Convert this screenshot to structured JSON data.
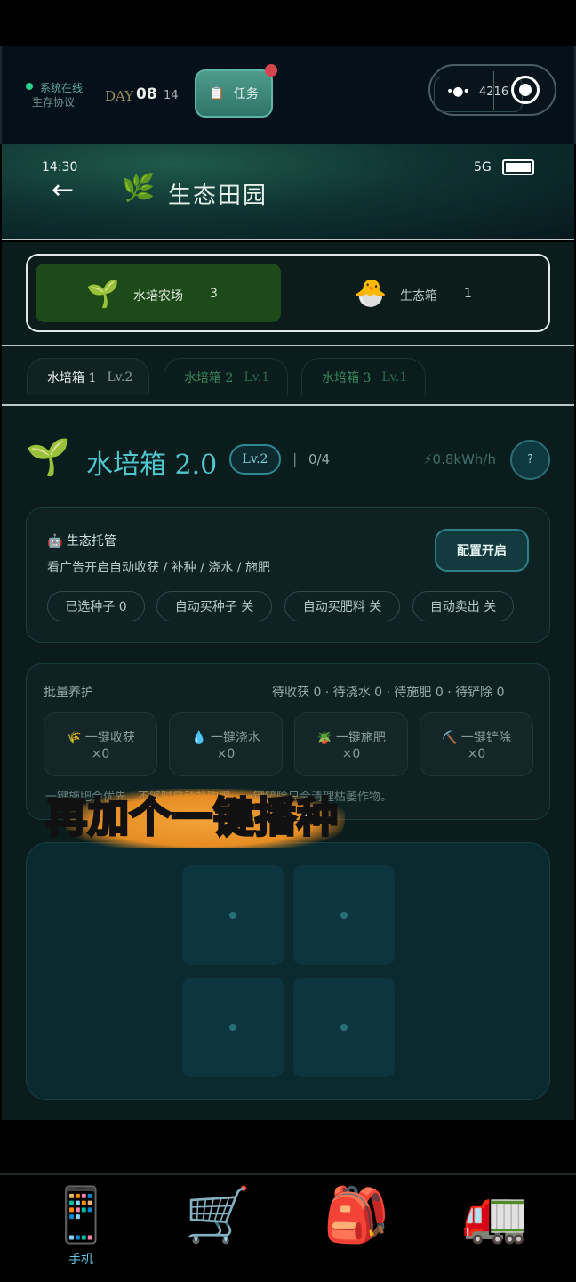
{
  "system": {
    "status": "系统在线",
    "protocol": "生存协议"
  },
  "day": {
    "label": "DAY",
    "value": "08",
    "sub": "14"
  },
  "task_button": {
    "icon": "clipboard-icon",
    "label": "任务"
  },
  "coins": {
    "value": "4216"
  },
  "statusbar": {
    "time": "14:30",
    "network": "5G"
  },
  "app": {
    "title": "生态田园"
  },
  "categories": [
    {
      "label": "水培农场",
      "count": "3",
      "icon": "seedling-icon"
    },
    {
      "label": "生态箱",
      "count": "1",
      "icon": "chick-icon"
    }
  ],
  "boxes": [
    {
      "name": "水培箱 1",
      "level": "Lv.2"
    },
    {
      "name": "水培箱 2",
      "level": "Lv.1"
    },
    {
      "name": "水培箱 3",
      "level": "Lv.1"
    }
  ],
  "box": {
    "title": "水培箱 2.0",
    "level": "Lv.2",
    "separator": "|",
    "slots": "0/4",
    "power": "⚡0.8kWh/h",
    "help": "?"
  },
  "eco": {
    "title": "🤖 生态托管",
    "desc": "看广告开启自动收获 / 补种 / 浇水 / 施肥",
    "config_button": "配置开启",
    "chips": [
      "已选种子 0",
      "自动买种子 关",
      "自动买肥料 关",
      "自动卖出 关"
    ]
  },
  "batch": {
    "title": "批量养护",
    "stats": "待收获 0 · 待浇水 0 · 待施肥 0 · 待铲除 0",
    "actions": [
      {
        "label": "🌾 一键收获",
        "count": "×0"
      },
      {
        "label": "💧 一键浇水",
        "count": "×0"
      },
      {
        "label": "🪴 一键施肥",
        "count": "×0"
      },
      {
        "label": "⛏️ 一键铲除",
        "count": "×0"
      }
    ],
    "note": "一键施肥会优先…不够时自动补购肥…一键铲除只会清理枯萎作物。"
  },
  "caption": "再加个一键播种",
  "nav": [
    {
      "icon": "phone-icon",
      "label": "手机"
    },
    {
      "icon": "cart-icon",
      "label": ""
    },
    {
      "icon": "backpack-icon",
      "label": ""
    },
    {
      "icon": "truck-icon",
      "label": ""
    }
  ]
}
